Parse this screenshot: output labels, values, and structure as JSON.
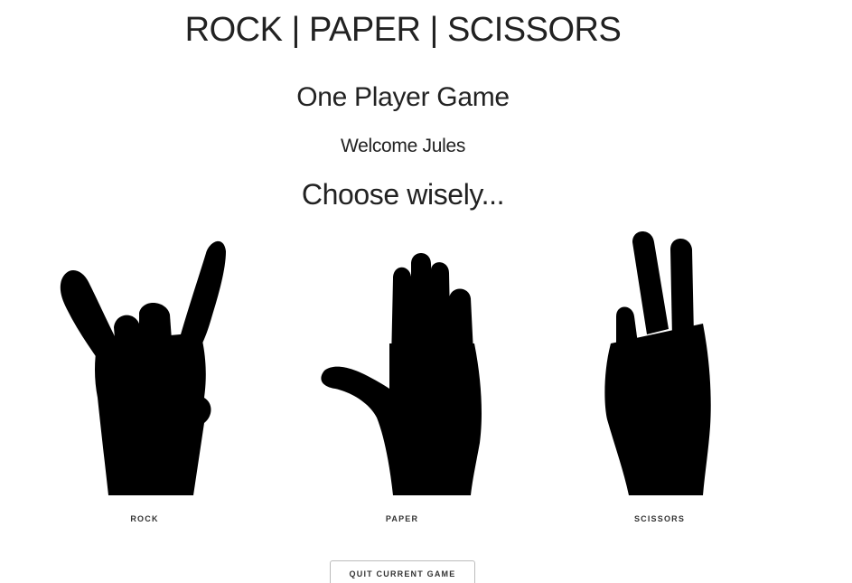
{
  "header": {
    "title": "ROCK | PAPER | SCISSORS"
  },
  "game": {
    "mode": "One Player Game",
    "welcome": "Welcome Jules",
    "prompt": "Choose wisely..."
  },
  "choices": [
    {
      "label": "ROCK",
      "icon": "rock-horns-hand-icon"
    },
    {
      "label": "PAPER",
      "icon": "paper-open-hand-icon"
    },
    {
      "label": "SCISSORS",
      "icon": "scissors-peace-hand-icon"
    }
  ],
  "actions": {
    "quit_label": "QUIT CURRENT GAME"
  },
  "colors": {
    "text": "#222222",
    "icon": "#000000",
    "background": "#ffffff",
    "button_border": "#bbbbbb"
  }
}
